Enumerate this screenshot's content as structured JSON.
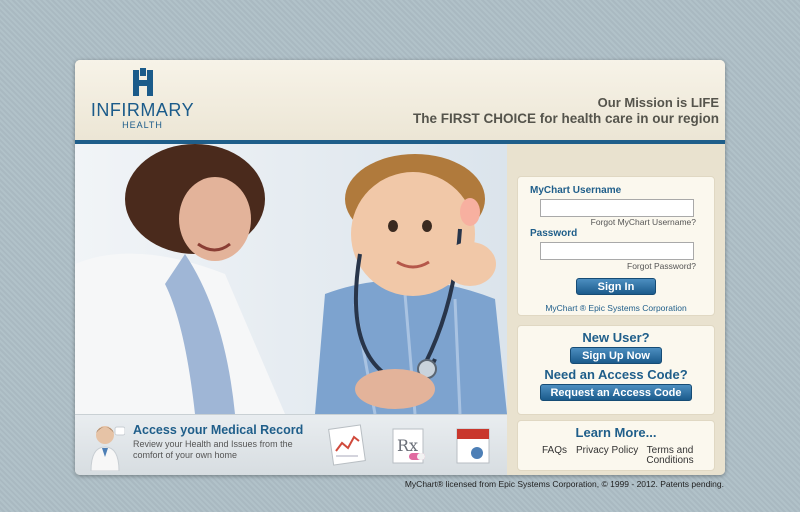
{
  "header": {
    "logo_name": "INFIRMARY",
    "logo_sub": "HEALTH",
    "mission_line1": "Our Mission is LIFE",
    "mission_line2": "The FIRST CHOICE for health care in our region"
  },
  "login": {
    "username_label": "MyChart Username",
    "username_value": "",
    "forgot_username": "Forgot MyChart Username?",
    "password_label": "Password",
    "password_value": "",
    "forgot_password": "Forgot Password?",
    "sign_in": "Sign In",
    "powered_by": "MyChart ® Epic Systems Corporation"
  },
  "new_user": {
    "heading": "New User?",
    "signup": "Sign Up Now",
    "access_heading": "Need an Access Code?",
    "request_access": "Request an Access Code"
  },
  "learn_more": {
    "heading": "Learn More...",
    "faqs": "FAQs",
    "privacy": "Privacy Policy",
    "terms_line1": "Terms and",
    "terms_line2": "Conditions"
  },
  "caption": {
    "title": "Access your Medical Record",
    "text": "Review your Health and Issues from the comfort of your own home"
  },
  "footer": {
    "text": "MyChart® licensed from Epic Systems Corporation, © 1999 - 2012. Patents pending."
  },
  "colors": {
    "brand_blue": "#1f5e8a",
    "button_blue": "#1b5b8c",
    "background": "#aebfc7",
    "panel_bg": "#fbf8ee"
  },
  "icons": [
    "infirmary-h-logo-icon",
    "doctor-avatar-icon",
    "chart-paper-icon",
    "prescription-icon",
    "calendar-icon"
  ]
}
